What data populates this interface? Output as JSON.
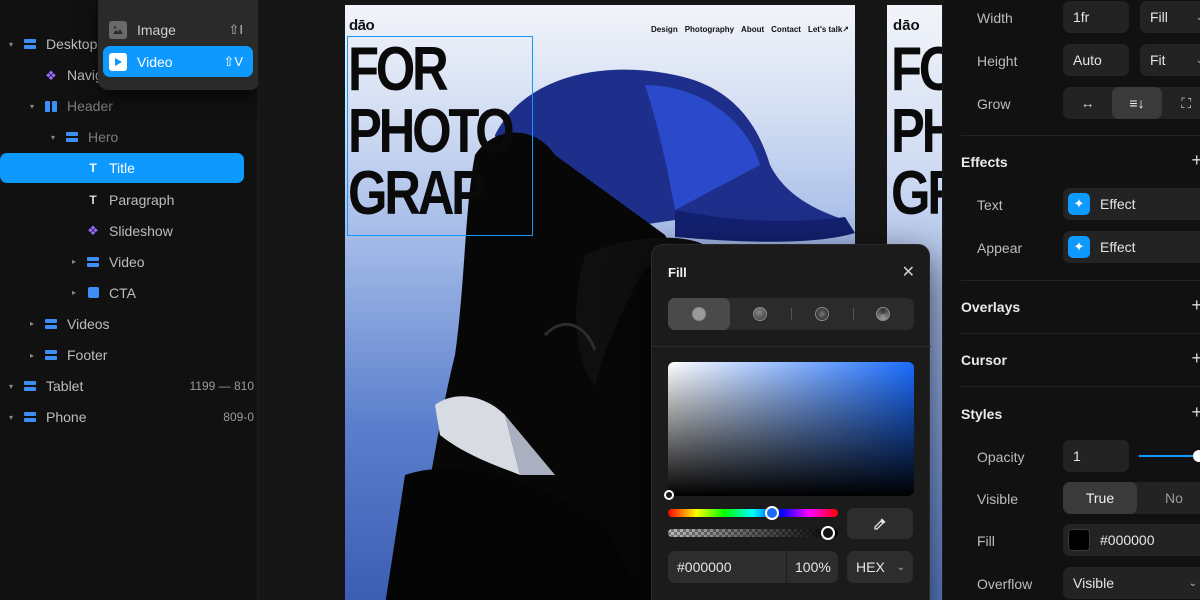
{
  "layers": {
    "items": [
      {
        "label": "Desktop",
        "depth": 0,
        "icon": "stack-icon",
        "caret": "▾"
      },
      {
        "label": "Navigation",
        "depth": 1,
        "icon": "component-icon",
        "caret": ""
      },
      {
        "label": "Header",
        "depth": 1,
        "icon": "columns-icon",
        "caret": "▾"
      },
      {
        "label": "Hero",
        "depth": 2,
        "icon": "stack-icon",
        "caret": "▾"
      },
      {
        "label": "Title",
        "depth": 3,
        "icon": "text-icon",
        "caret": "",
        "selected": true
      },
      {
        "label": "Paragraph",
        "depth": 3,
        "icon": "text-icon",
        "caret": ""
      },
      {
        "label": "Slideshow",
        "depth": 3,
        "icon": "component-icon",
        "caret": ""
      },
      {
        "label": "Video",
        "depth": 3,
        "icon": "stack-icon",
        "caret": "▸"
      },
      {
        "label": "CTA",
        "depth": 3,
        "icon": "square-icon",
        "caret": "▸"
      },
      {
        "label": "Videos",
        "depth": 1,
        "icon": "stack-icon",
        "caret": "▸"
      },
      {
        "label": "Footer",
        "depth": 1,
        "icon": "stack-icon",
        "caret": "▸"
      },
      {
        "label": "Tablet",
        "depth": 0,
        "icon": "stack-icon",
        "caret": "▾",
        "meta": "1199 — 810"
      },
      {
        "label": "Phone",
        "depth": 0,
        "icon": "stack-icon",
        "caret": "▾",
        "meta": "809-0"
      }
    ]
  },
  "insert_menu": {
    "items": [
      {
        "label": "Image",
        "shortcut": "⇧I",
        "icon": "image-icon"
      },
      {
        "label": "Video",
        "shortcut": "⇧V",
        "icon": "play-icon",
        "active": true
      }
    ]
  },
  "site": {
    "logo": "dāo",
    "nav": [
      "Design",
      "Photography",
      "About",
      "Contact",
      "Let's talk↗"
    ],
    "hero_title": "FOR\nPHOTO\nGRAP"
  },
  "tablet": {
    "logo": "dāo",
    "hero_title": "FO\nPH\nGR"
  },
  "fill_popover": {
    "title": "Fill",
    "hex": "#000000",
    "opacity": "100%",
    "mode": "HEX",
    "hue_color": "#1a6cff"
  },
  "props": {
    "layout": {
      "width_label": "Width",
      "width_value": "1fr",
      "width_mode": "Fill",
      "height_label": "Height",
      "height_value": "Auto",
      "height_mode": "Fit",
      "grow_label": "Grow"
    },
    "effects": {
      "title": "Effects",
      "text_label": "Text",
      "text_value": "Effect",
      "appear_label": "Appear",
      "appear_value": "Effect"
    },
    "overlays_title": "Overlays",
    "cursor_title": "Cursor",
    "styles": {
      "title": "Styles",
      "opacity_label": "Opacity",
      "opacity_value": "1",
      "visible_label": "Visible",
      "visible_true": "True",
      "visible_false": "No",
      "fill_label": "Fill",
      "fill_value": "#000000",
      "overflow_label": "Overflow",
      "overflow_value": "Visible"
    }
  },
  "colors": {
    "accent": "#0e99ff",
    "layer_icon": "#3d8ef7",
    "component_icon": "#9b6bff"
  }
}
